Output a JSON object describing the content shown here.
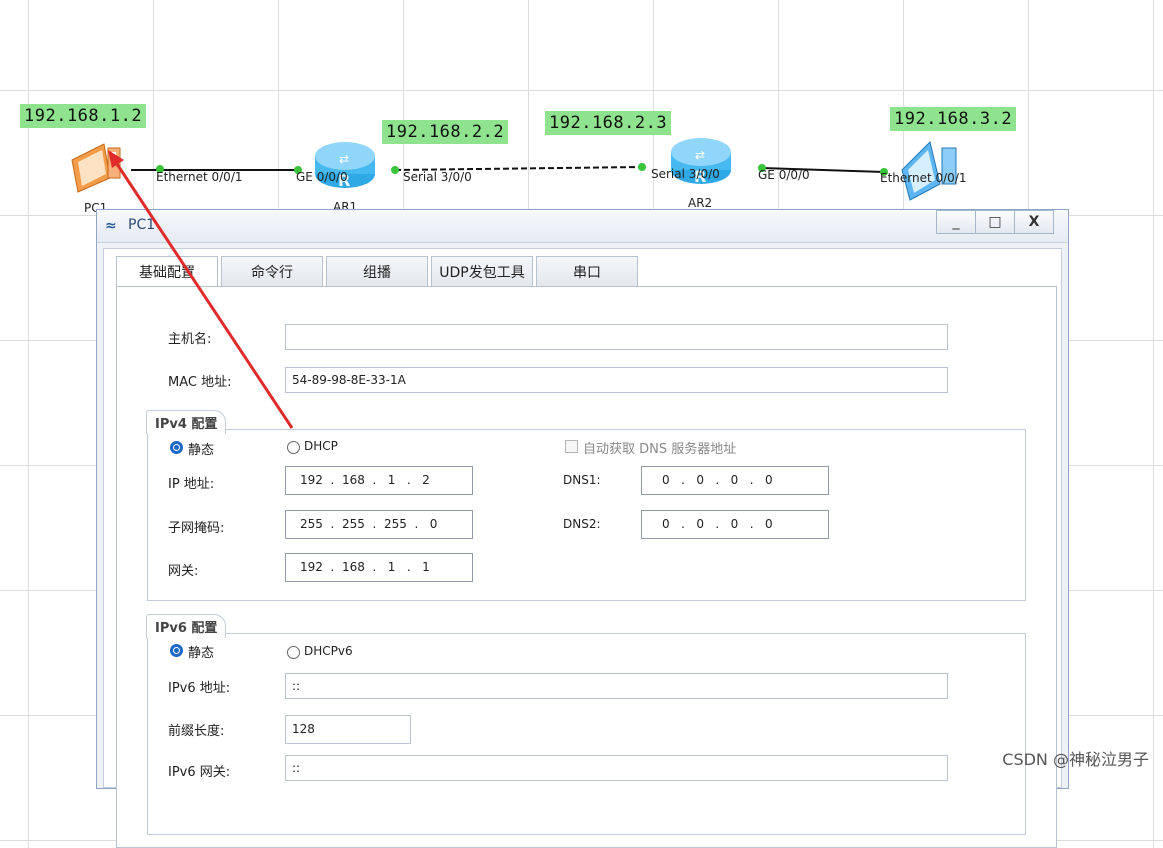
{
  "topology": {
    "ip_tags": [
      "192.168.1.2",
      "192.168.2.2",
      "192.168.2.3",
      "192.168.3.2"
    ],
    "interface_labels": [
      "Ethernet 0/0/1",
      "GE 0/0/0",
      "Serial 3/0/0",
      "Serial 3/0/0",
      "GE 0/0/0",
      "Ethernet 0/0/1"
    ],
    "device_labels": [
      "PC1",
      "AR1",
      "AR2"
    ]
  },
  "window": {
    "title": "PC1",
    "minimize": "_",
    "maximize": "□",
    "close": "X"
  },
  "tabs": [
    "基础配置",
    "命令行",
    "组播",
    "UDP发包工具",
    "串口"
  ],
  "basic": {
    "hostname_label": "主机名:",
    "hostname_value": "",
    "mac_label": "MAC 地址:",
    "mac_value": "54-89-98-8E-33-1A"
  },
  "ipv4": {
    "group_title": "IPv4 配置",
    "static_label": "静态",
    "dhcp_label": "DHCP",
    "auto_dns_label": "自动获取 DNS 服务器地址",
    "ip_label": "IP 地址:",
    "ip_value": "192  .  168  .   1   .   2",
    "mask_label": "子网掩码:",
    "mask_value": "255  .  255  .  255  .   0",
    "gateway_label": "网关:",
    "gateway_value": "192  .  168  .   1   .   1",
    "dns1_label": "DNS1:",
    "dns1_value": "0   .   0   .   0   .   0",
    "dns2_label": "DNS2:",
    "dns2_value": "0   .   0   .   0   .   0"
  },
  "ipv6": {
    "group_title": "IPv6 配置",
    "static_label": "静态",
    "dhcp_label": "DHCPv6",
    "ip_label": "IPv6 地址:",
    "ip_value": "::",
    "prefix_label": "前缀长度:",
    "prefix_value": "128",
    "gateway_label": "IPv6 网关:",
    "gateway_value": "::"
  },
  "watermark": "CSDN @神秘泣男子",
  "colors": {
    "tag_bg": "#8fe38f",
    "arrow": "#e02b2b",
    "radio": "#1c68c7"
  }
}
